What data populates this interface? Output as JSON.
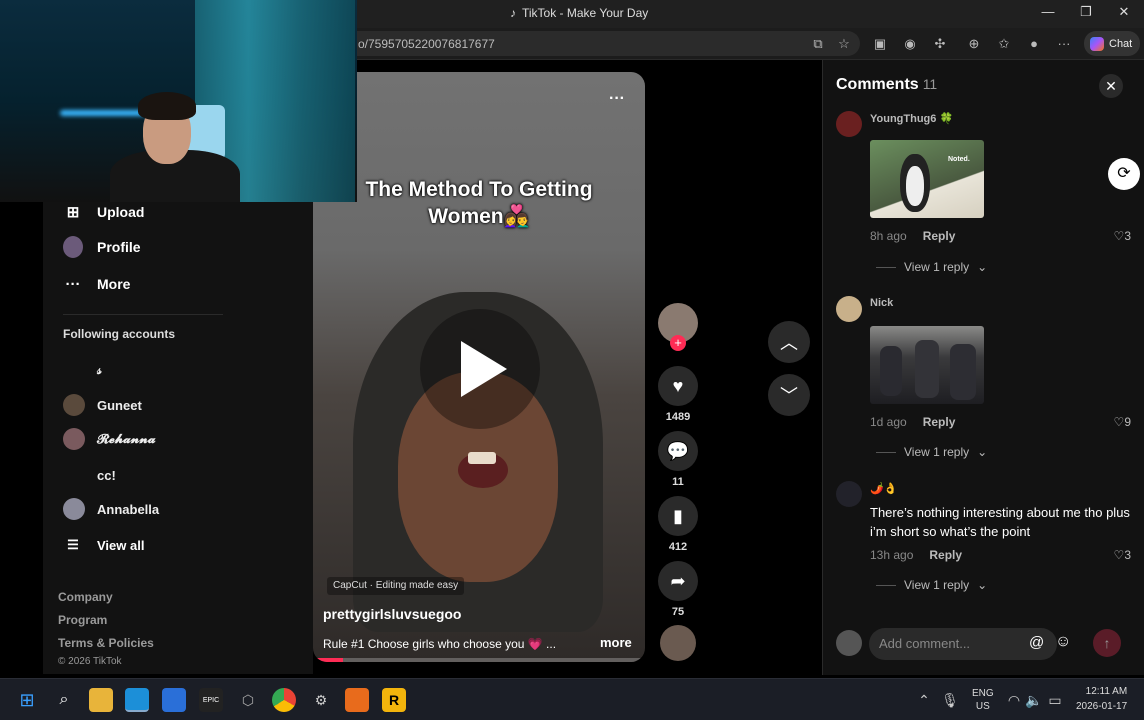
{
  "window": {
    "title": "TikTok - Make Your Day"
  },
  "address": {
    "url": "o/7595705220076817677"
  },
  "toolbar": {
    "chat_label": "Chat"
  },
  "sidebar": {
    "nav": [
      {
        "label": "Upload",
        "icon": "plus-square-icon"
      },
      {
        "label": "Profile",
        "icon": "avatar-icon"
      },
      {
        "label": "More",
        "icon": "ellipsis-icon"
      }
    ],
    "following_title": "Following accounts",
    "following": [
      {
        "name": "𝓈"
      },
      {
        "name": "Guneet"
      },
      {
        "name": "𝓡𝓮𝓱𝓪𝓷𝓷𝓪"
      },
      {
        "name": "cc!"
      },
      {
        "name": "Annabella"
      }
    ],
    "view_all": "View all",
    "footer": [
      "Company",
      "Program",
      "Terms & Policies"
    ],
    "copyright": "© 2026 TikTok"
  },
  "video": {
    "caption_line1": "The Method To Getting",
    "caption_line2": "Women👩‍❤️‍👨",
    "watermark": "CapCut · Editing made easy",
    "author": "prettygirlsluvsuegoo",
    "description": "Rule #1 Choose girls who choose you 💗 ...",
    "more_label": "more",
    "progress": 0.09
  },
  "actions": {
    "likes": "1489",
    "comments": "11",
    "saves": "412",
    "shares": "75"
  },
  "comments_panel": {
    "title": "Comments",
    "count": "11",
    "items": [
      {
        "user": "YoungThug6 🍀",
        "time": "8h ago",
        "reply": "Reply",
        "likes": "3",
        "view_replies": "View 1 reply",
        "image_text": "Noted."
      },
      {
        "user": "Nick",
        "time": "1d ago",
        "reply": "Reply",
        "likes": "9",
        "view_replies": "View 1 reply"
      },
      {
        "user": "🌶️👌",
        "text": "There’s nothing interesting about me tho plus i’m short so what’s the point",
        "time": "13h ago",
        "reply": "Reply",
        "likes": "3",
        "view_replies": "View 1 reply"
      }
    ],
    "input_placeholder": "Add comment..."
  },
  "taskbar": {
    "lang_line1": "ENG",
    "lang_line2": "US",
    "time": "12:11 AM",
    "date": "2026-01-17"
  }
}
